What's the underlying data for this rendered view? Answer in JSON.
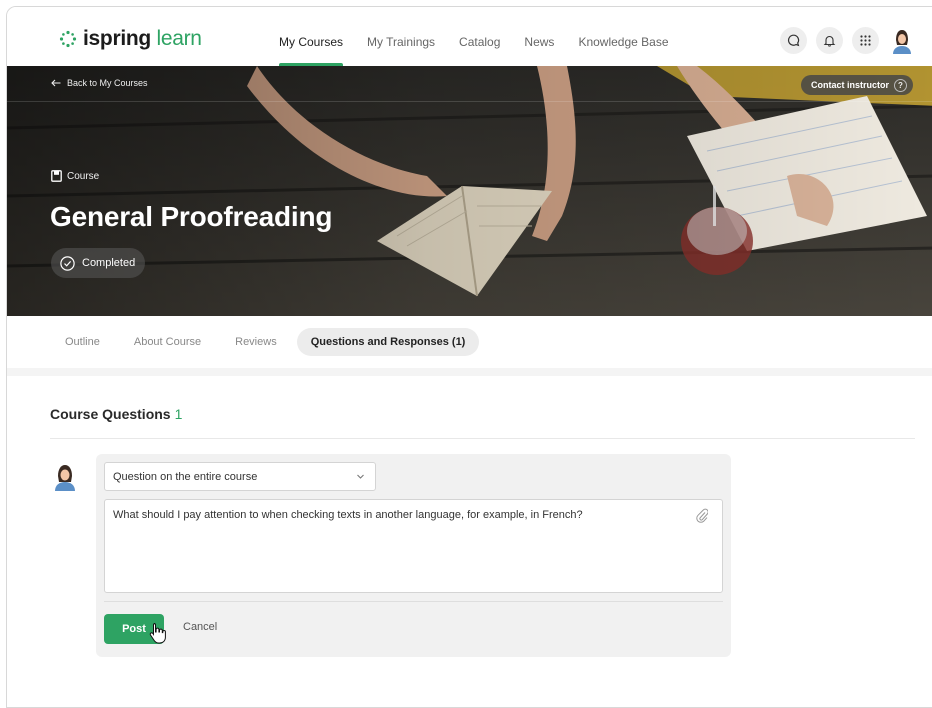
{
  "header": {
    "logo_main": "ispring",
    "logo_accent": "learn",
    "nav": [
      {
        "label": "My Courses",
        "active": true
      },
      {
        "label": "My Trainings",
        "active": false
      },
      {
        "label": "Catalog",
        "active": false
      },
      {
        "label": "News",
        "active": false
      },
      {
        "label": "Knowledge Base",
        "active": false
      }
    ],
    "icons": [
      "chat-icon",
      "bell-icon",
      "apps-grid-icon",
      "user-avatar"
    ]
  },
  "hero": {
    "back_label": "Back to My Courses",
    "contact_label": "Contact instructor",
    "help_glyph": "?",
    "course_kind": "Course",
    "title": "General Proofreading",
    "status": "Completed"
  },
  "tabs": [
    {
      "label": "Outline",
      "active": false
    },
    {
      "label": "About Course",
      "active": false
    },
    {
      "label": "Reviews",
      "active": false
    },
    {
      "label": "Questions and Responses (1)",
      "active": true
    }
  ],
  "questions": {
    "heading": "Course Questions",
    "count": "1",
    "scope_selected": "Question on the entire course",
    "question_text": "What should I pay attention to when checking texts in another language, for example, in French?",
    "post_label": "Post",
    "cancel_label": "Cancel"
  },
  "colors": {
    "accent": "#2ea363",
    "tab_active_bg": "#ececec",
    "panel_bg": "#f1f1f1"
  }
}
